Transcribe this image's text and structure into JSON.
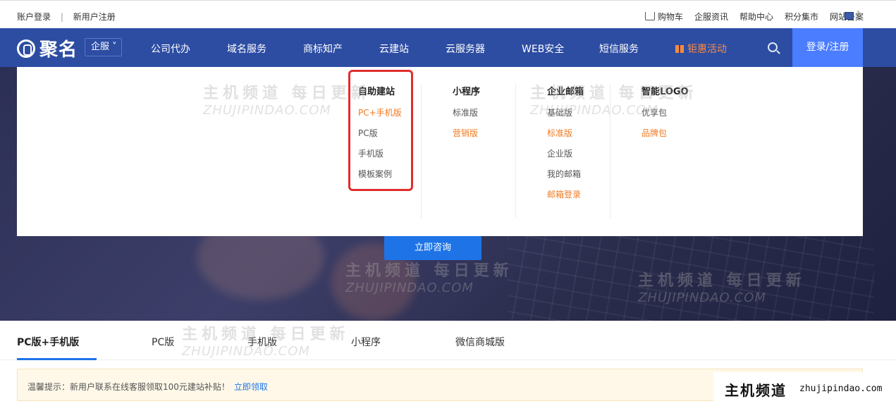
{
  "topbar": {
    "login": "账户登录",
    "separator": "|",
    "register": "新用户注册",
    "links": [
      "购物车",
      "企服资讯",
      "帮助中心",
      "积分集市",
      "网站备案"
    ],
    "cart_icon": "cart-icon",
    "lang_chevron": "˅"
  },
  "nav": {
    "logo_text": "聚名",
    "qifu_label": "企服 ˅",
    "items": [
      "公司代办",
      "域名服务",
      "商标知产",
      "云建站",
      "云服务器",
      "WEB安全",
      "短信服务",
      "钜惠活动"
    ],
    "login_label": "登录/注册"
  },
  "dropdown": {
    "columns": [
      {
        "title": "自助建站",
        "links": [
          "PC+手机版",
          "PC版",
          "手机版",
          "模板案例"
        ]
      },
      {
        "title": "小程序",
        "links": [
          "标准版",
          "营销版"
        ]
      },
      {
        "title": "企业邮箱",
        "links": [
          "基础版",
          "标准版",
          "企业版",
          "我的邮箱",
          "邮箱登录"
        ]
      },
      {
        "title": "智能LOGO",
        "links": [
          "优享包",
          "品牌包"
        ]
      }
    ]
  },
  "hero": {
    "consult_label": "立即咨询"
  },
  "tabs": [
    "PC版+手机版",
    "PC版",
    "手机版",
    "小程序",
    "微信商城版"
  ],
  "notice": {
    "text": "温馨提示：新用户联系在线客服领取100元建站补贴！",
    "link": "立即领取"
  },
  "watermark": {
    "cn": "主机频道 每日更新",
    "en": "ZHUJIPINDAO.COM",
    "brand_cn": "主机频道",
    "brand_en": "zhujipindao.com"
  },
  "colors": {
    "nav_bg": "#2d4da3",
    "accent_blue": "#1e74e6",
    "login_bg": "#4a7dff",
    "highlight_orange": "#f07a22",
    "red_box": "#e02d2d"
  }
}
